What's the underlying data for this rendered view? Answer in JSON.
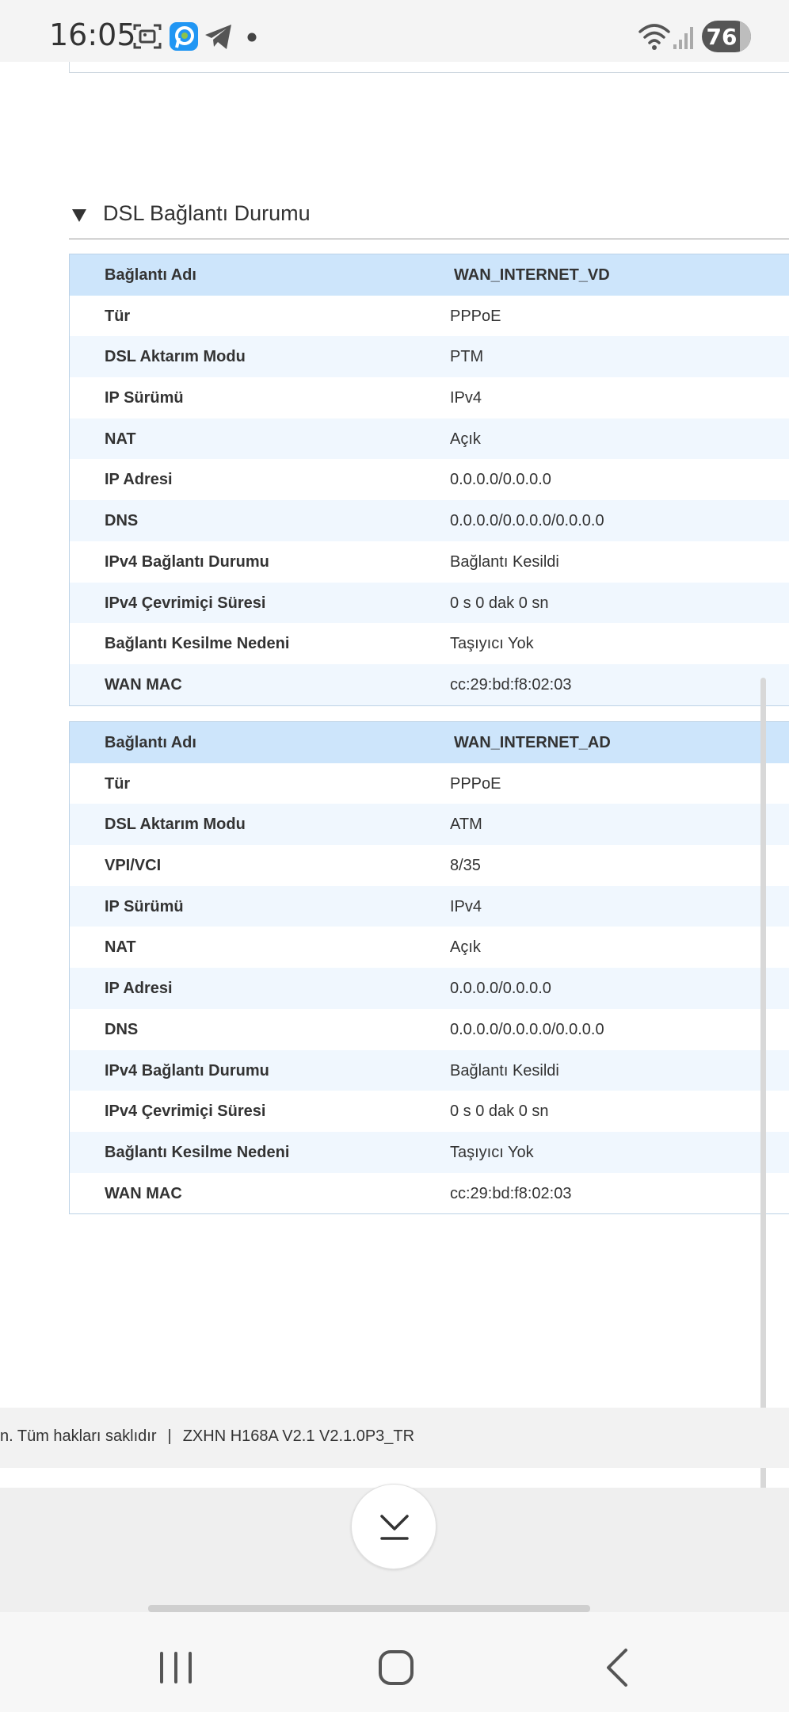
{
  "status_bar": {
    "time": "16:05",
    "battery": "76",
    "icons": [
      "screenshot-icon",
      "app-icon",
      "telegram-icon",
      "dot-icon",
      "wifi-icon",
      "signal-icon"
    ]
  },
  "section": {
    "title": "DSL Bağlantı Durumu"
  },
  "tables": [
    {
      "rows": [
        {
          "label": "Bağlantı Adı",
          "value": "WAN_INTERNET_VD"
        },
        {
          "label": "Tür",
          "value": "PPPoE"
        },
        {
          "label": "DSL Aktarım Modu",
          "value": "PTM"
        },
        {
          "label": "IP Sürümü",
          "value": "IPv4"
        },
        {
          "label": "NAT",
          "value": "Açık"
        },
        {
          "label": "IP Adresi",
          "value": "0.0.0.0/0.0.0.0"
        },
        {
          "label": "DNS",
          "value": "0.0.0.0/0.0.0.0/0.0.0.0"
        },
        {
          "label": "IPv4 Bağlantı Durumu",
          "value": "Bağlantı Kesildi"
        },
        {
          "label": "IPv4 Çevrimiçi Süresi",
          "value": "0 s 0 dak 0 sn"
        },
        {
          "label": "Bağlantı Kesilme Nedeni",
          "value": "Taşıyıcı Yok"
        },
        {
          "label": "WAN MAC",
          "value": "cc:29:bd:f8:02:03"
        }
      ]
    },
    {
      "rows": [
        {
          "label": "Bağlantı Adı",
          "value": "WAN_INTERNET_AD"
        },
        {
          "label": "Tür",
          "value": "PPPoE"
        },
        {
          "label": "DSL Aktarım Modu",
          "value": "ATM"
        },
        {
          "label": "VPI/VCI",
          "value": "8/35"
        },
        {
          "label": "IP Sürümü",
          "value": "IPv4"
        },
        {
          "label": "NAT",
          "value": "Açık"
        },
        {
          "label": "IP Adresi",
          "value": "0.0.0.0/0.0.0.0"
        },
        {
          "label": "DNS",
          "value": "0.0.0.0/0.0.0.0/0.0.0.0"
        },
        {
          "label": "IPv4 Bağlantı Durumu",
          "value": "Bağlantı Kesildi"
        },
        {
          "label": "IPv4 Çevrimiçi Süresi",
          "value": "0 s 0 dak 0 sn"
        },
        {
          "label": "Bağlantı Kesilme Nedeni",
          "value": "Taşıyıcı Yok"
        },
        {
          "label": "WAN MAC",
          "value": "cc:29:bd:f8:02:03"
        }
      ]
    }
  ],
  "footer": {
    "copyright": "n. Tüm hakları saklıdır",
    "separator": "|",
    "version": "ZXHN H168A V2.1 V2.1.0P3_TR"
  },
  "colors": {
    "header_row": "#cde5fb",
    "alt_row": "#f0f7fe",
    "border": "#bcd2e6"
  }
}
